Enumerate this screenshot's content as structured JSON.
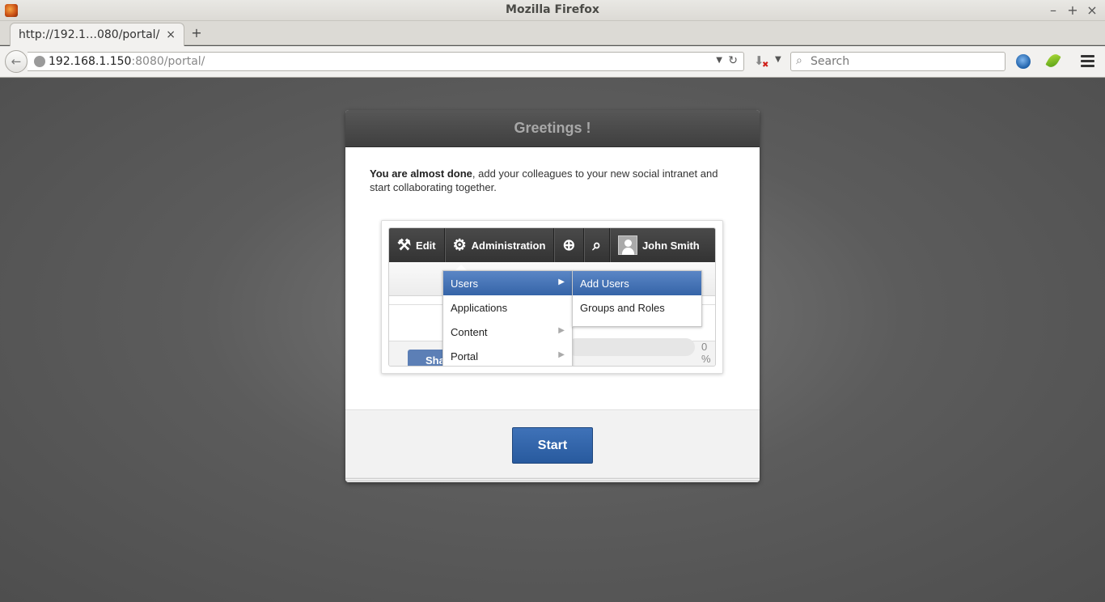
{
  "window": {
    "title": "Mozilla Firefox",
    "controls": {
      "minimize": "–",
      "maximize": "+",
      "close": "×"
    }
  },
  "tabs": [
    {
      "title": "http://192.1…080/portal/",
      "close": "×",
      "active": true
    }
  ],
  "new_tab": "+",
  "navbar": {
    "url_host": "192.168.1.150",
    "url_rest": ":8080/portal/",
    "search_placeholder": "Search"
  },
  "dialog": {
    "title": "Greetings !",
    "intro_bold": "You are almost done",
    "intro_rest": ", add your colleagues to your new social intranet and start collaborating together.",
    "preview": {
      "toolbar": [
        "Edit",
        "Administration",
        "John Smith"
      ],
      "menu": [
        {
          "label": "Users",
          "selected": true,
          "has_submenu": true
        },
        {
          "label": "Applications",
          "selected": false,
          "has_submenu": false
        },
        {
          "label": "Content",
          "selected": false,
          "has_submenu": true
        },
        {
          "label": "Portal",
          "selected": false,
          "has_submenu": true
        }
      ],
      "submenu": [
        {
          "label": "Add Users",
          "selected": true
        },
        {
          "label": "Groups and Roles",
          "selected": false
        }
      ],
      "share_button": "Share",
      "progress_percent": "0 %"
    },
    "start_button": "Start"
  },
  "colors": {
    "accent": "#3564a8",
    "button": "#2f62a8",
    "header": "#4a4a4a",
    "background": "#555555"
  },
  "icons": {
    "app": "firefox-icon",
    "back": "back-arrow-icon",
    "globe": "globe-icon",
    "reload": "reload-icon",
    "download": "download-icon",
    "search": "search-icon",
    "menu": "hamburger-menu-icon"
  }
}
